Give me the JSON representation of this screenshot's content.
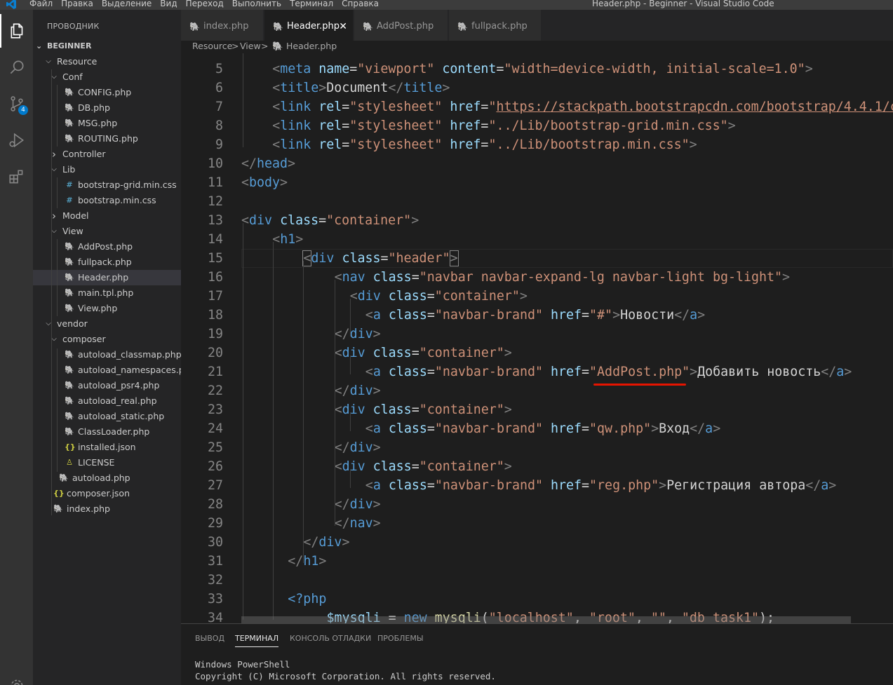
{
  "titlebar": {
    "menus": [
      "Файл",
      "Правка",
      "Выделение",
      "Вид",
      "Переход",
      "Выполнить",
      "Терминал",
      "Справка"
    ],
    "window_title": "Header.php - Beginner - Visual Studio Code"
  },
  "activitybar": {
    "items": [
      "files-icon",
      "search-icon",
      "source-control-icon",
      "run-debug-icon",
      "extensions-icon"
    ],
    "scm_badge": "4"
  },
  "sidebar": {
    "title": "ПРОВОДНИК",
    "section": "BEGINNER",
    "tree": [
      {
        "label": "Resource",
        "type": "folder-open"
      },
      {
        "label": "Conf",
        "type": "folder-open"
      },
      {
        "label": "CONFIG.php",
        "type": "php"
      },
      {
        "label": "DB.php",
        "type": "php"
      },
      {
        "label": "MSG.php",
        "type": "php"
      },
      {
        "label": "ROUTING.php",
        "type": "php"
      },
      {
        "label": "Controller",
        "type": "folder-closed"
      },
      {
        "label": "Lib",
        "type": "folder-open"
      },
      {
        "label": "bootstrap-grid.min.css",
        "type": "css"
      },
      {
        "label": "bootstrap.min.css",
        "type": "css"
      },
      {
        "label": "Model",
        "type": "folder-closed"
      },
      {
        "label": "View",
        "type": "folder-open"
      },
      {
        "label": "AddPost.php",
        "type": "php"
      },
      {
        "label": "fullpack.php",
        "type": "php"
      },
      {
        "label": "Header.php",
        "type": "php"
      },
      {
        "label": "main.tpl.php",
        "type": "php"
      },
      {
        "label": "View.php",
        "type": "php"
      },
      {
        "label": "vendor",
        "type": "folder-open"
      },
      {
        "label": "composer",
        "type": "folder-open"
      },
      {
        "label": "autoload_classmap.php",
        "type": "php"
      },
      {
        "label": "autoload_namespaces.php",
        "type": "php"
      },
      {
        "label": "autoload_psr4.php",
        "type": "php"
      },
      {
        "label": "autoload_real.php",
        "type": "php"
      },
      {
        "label": "autoload_static.php",
        "type": "php"
      },
      {
        "label": "ClassLoader.php",
        "type": "php"
      },
      {
        "label": "installed.json",
        "type": "json"
      },
      {
        "label": "LICENSE",
        "type": "license"
      },
      {
        "label": "autoload.php",
        "type": "php"
      },
      {
        "label": "composer.json",
        "type": "json"
      },
      {
        "label": "index.php",
        "type": "php"
      }
    ],
    "selected": "Header.php"
  },
  "tabs": [
    {
      "label": "index.php",
      "active": false
    },
    {
      "label": "Header.php",
      "active": true
    },
    {
      "label": "AddPost.php",
      "active": false
    },
    {
      "label": "fullpack.php",
      "active": false
    }
  ],
  "breadcrumb": {
    "parts": [
      "Resource",
      ">",
      "View",
      ">",
      "Header.php"
    ]
  },
  "editor": {
    "line_numbers": [
      "5",
      "6",
      "7",
      "8",
      "9",
      "10",
      "11",
      "12",
      "13",
      "14",
      "15",
      "16",
      "17",
      "18",
      "19",
      "20",
      "21",
      "22",
      "23",
      "24",
      "25",
      "26",
      "27",
      "28",
      "29",
      "30",
      "31",
      "32",
      "33",
      "34"
    ],
    "code": {
      "l5": [
        "<",
        "meta",
        " ",
        "name",
        "=",
        "\"viewport\"",
        " ",
        "content",
        "=",
        "\"width=device-width, initial-scale=1.0\"",
        ">"
      ],
      "l6": [
        "<",
        "title",
        ">",
        "Document",
        "</",
        "title",
        ">"
      ],
      "l7": [
        "<",
        "link",
        " ",
        "rel",
        "=",
        "\"stylesheet\"",
        " ",
        "href",
        "=",
        "\"",
        "https://stackpath.bootstrapcdn.com/bootstrap/4.4.1/c"
      ],
      "l8": [
        "<",
        "link",
        " ",
        "rel",
        "=",
        "\"stylesheet\"",
        " ",
        "href",
        "=",
        "\"../Lib/bootstrap-grid.min.css\"",
        ">"
      ],
      "l9": [
        "<",
        "link",
        " ",
        "rel",
        "=",
        "\"stylesheet\"",
        " ",
        "href",
        "=",
        "\"../Lib/bootstrap.min.css\"",
        ">"
      ],
      "l10": [
        "</",
        "head",
        ">"
      ],
      "l11": [
        "<",
        "body",
        ">"
      ],
      "l13": [
        "<",
        "div",
        " ",
        "class",
        "=",
        "\"container\"",
        ">"
      ],
      "l14": [
        "<",
        "h1",
        ">"
      ],
      "l15": [
        "<",
        "div",
        " ",
        "class",
        "=",
        "\"header\"",
        ">"
      ],
      "l16": [
        "<",
        "nav",
        " ",
        "class",
        "=",
        "\"navbar navbar-expand-lg navbar-light bg-light\"",
        ">"
      ],
      "l17": [
        "<",
        "div",
        " ",
        "class",
        "=",
        "\"container\"",
        ">"
      ],
      "l18": [
        "<",
        "a",
        " ",
        "class",
        "=",
        "\"navbar-brand\"",
        " ",
        "href",
        "=",
        "\"#\"",
        ">",
        "Новости",
        "</",
        "a",
        ">"
      ],
      "l19": [
        "</",
        "div",
        ">"
      ],
      "l20": [
        "<",
        "div",
        " ",
        "class",
        "=",
        "\"container\"",
        ">"
      ],
      "l21": [
        "<",
        "a",
        " ",
        "class",
        "=",
        "\"navbar-brand\"",
        " ",
        "href",
        "=",
        "\"AddPost.php\"",
        ">",
        "Добавить новость",
        "</",
        "a",
        ">"
      ],
      "l22": [
        "</",
        "div",
        ">"
      ],
      "l23": [
        "<",
        "div",
        " ",
        "class",
        "=",
        "\"container\"",
        ">"
      ],
      "l24": [
        "<",
        "a",
        " ",
        "class",
        "=",
        "\"navbar-brand\"",
        " ",
        "href",
        "=",
        "\"qw.php\"",
        ">",
        "Вход",
        "</",
        "a",
        ">"
      ],
      "l25": [
        "</",
        "div",
        ">"
      ],
      "l26": [
        "<",
        "div",
        " ",
        "class",
        "=",
        "\"container\"",
        ">"
      ],
      "l27": [
        "<",
        "a",
        " ",
        "class",
        "=",
        "\"navbar-brand\"",
        " ",
        "href",
        "=",
        "\"reg.php\"",
        ">",
        "Регистрация автора",
        "</",
        "a",
        ">"
      ],
      "l28": [
        "</",
        "div",
        ">"
      ],
      "l29": [
        "</",
        "nav",
        ">"
      ],
      "l30": [
        "</",
        "div",
        ">"
      ],
      "l31": [
        "</",
        "h1",
        ">"
      ],
      "l33": [
        "<?php"
      ],
      "l34": [
        "$mysqli",
        " = ",
        "new",
        " ",
        "mysqli",
        "(",
        "\"localhost\"",
        ", ",
        "\"root\"",
        ", ",
        "\"\"",
        ", ",
        "\"db_task1\"",
        ");"
      ]
    }
  },
  "panel": {
    "tabs": [
      "ВЫВОД",
      "ТЕРМИНАЛ",
      "КОНСОЛЬ ОТЛАДКИ",
      "ПРОБЛЕМЫ"
    ],
    "active_tab": "ТЕРМИНАЛ",
    "terminal_lines": [
      "Windows PowerShell",
      "Copyright (C) Microsoft Corporation. All rights reserved."
    ]
  },
  "colors": {
    "tag": "#569cd6",
    "attribute": "#9cdcfe",
    "string": "#ce9178",
    "punctuation": "#808080",
    "text": "#d4d4d4",
    "function": "#dcdcaa",
    "annotation_underline": "#e51400",
    "accent": "#007acc"
  }
}
